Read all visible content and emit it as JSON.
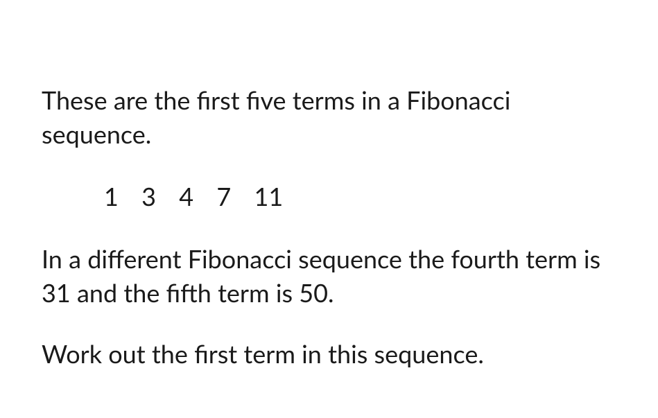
{
  "question": {
    "intro": "These are the first five terms in a Fibonacci sequence.",
    "sequence": [
      "1",
      "3",
      "4",
      "7",
      "11"
    ],
    "condition": "In a different Fibonacci sequence the fourth term is 31 and the fifth term is 50.",
    "task": "Work out the first term in this sequence."
  }
}
